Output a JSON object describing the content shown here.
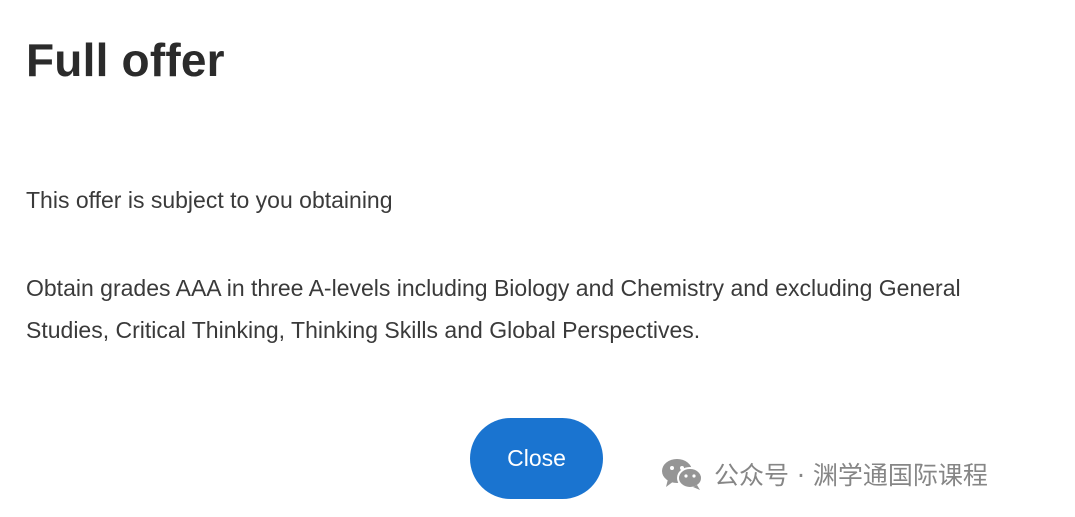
{
  "dialog": {
    "title": "Full offer",
    "intro": "This offer is subject to you obtaining",
    "condition": "Obtain grades AAA in three A-levels including Biology and Chemistry and excluding General Studies, Critical Thinking, Thinking Skills and Global Perspectives.",
    "close_label": "Close"
  },
  "watermark": {
    "icon": "wechat-icon",
    "text": "公众号 · 渊学通国际课程"
  },
  "colors": {
    "accent": "#1a74d0",
    "text": "#333333",
    "background": "#ffffff",
    "watermark": "#7a7a7a"
  }
}
